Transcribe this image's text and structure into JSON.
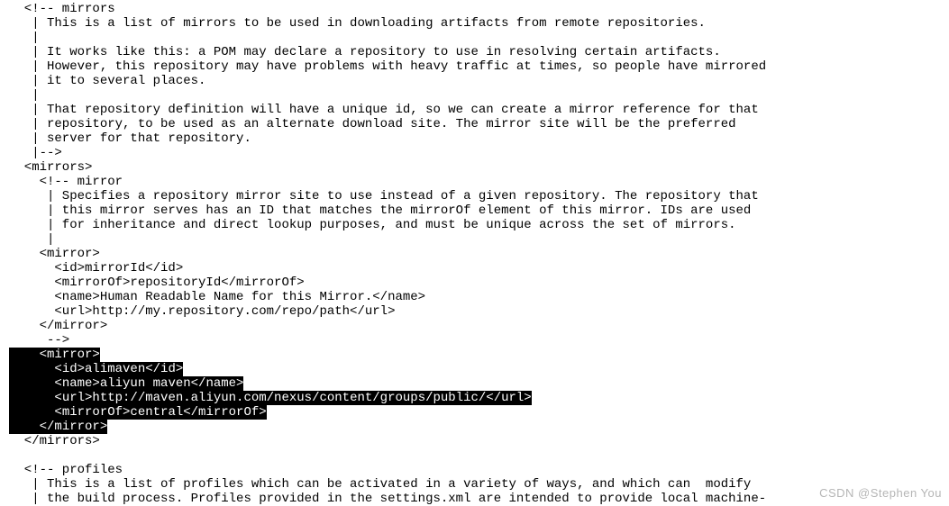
{
  "code": {
    "l01": "  <!-- mirrors",
    "l02": "   | This is a list of mirrors to be used in downloading artifacts from remote repositories.",
    "l03": "   |",
    "l04": "   | It works like this: a POM may declare a repository to use in resolving certain artifacts.",
    "l05": "   | However, this repository may have problems with heavy traffic at times, so people have mirrored",
    "l06": "   | it to several places.",
    "l07": "   |",
    "l08": "   | That repository definition will have a unique id, so we can create a mirror reference for that",
    "l09": "   | repository, to be used as an alternate download site. The mirror site will be the preferred",
    "l10": "   | server for that repository.",
    "l11": "   |-->",
    "l12": "  <mirrors>",
    "l13": "    <!-- mirror",
    "l14": "     | Specifies a repository mirror site to use instead of a given repository. The repository that",
    "l15": "     | this mirror serves has an ID that matches the mirrorOf element of this mirror. IDs are used",
    "l16": "     | for inheritance and direct lookup purposes, and must be unique across the set of mirrors.",
    "l17": "     |",
    "l18": "    <mirror>",
    "l19": "      <id>mirrorId</id>",
    "l20": "      <mirrorOf>repositoryId</mirrorOf>",
    "l21": "      <name>Human Readable Name for this Mirror.</name>",
    "l22": "      <url>http://my.repository.com/repo/path</url>",
    "l23": "    </mirror>",
    "l24": "     -->",
    "l25a": "    ",
    "l25b": "<mirror>",
    "l26a": "      ",
    "l26b": "<id>alimaven</id>",
    "l27a": "      ",
    "l27b": "<name>aliyun maven</name>",
    "l28a": "      ",
    "l28b": "<url>http://maven.aliyun.com/nexus/content/groups/public/</url>",
    "l29a": "      ",
    "l29b": "<mirrorOf>central</mirrorOf>",
    "l30a": "    ",
    "l30b": "</mirror>",
    "l31": "  </mirrors>",
    "l32": "",
    "l33": "  <!-- profiles",
    "l34": "   | This is a list of profiles which can be activated in a variety of ways, and which can  modify",
    "l35": "   | the build process. Profiles provided in the settings.xml are intended to provide local machine-"
  },
  "watermark": "CSDN @Stephen You"
}
